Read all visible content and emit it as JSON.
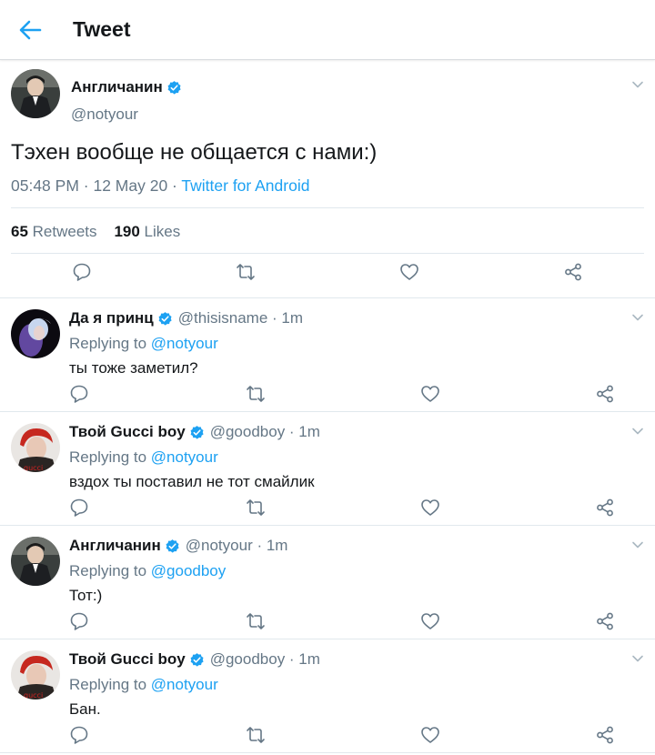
{
  "header": {
    "title": "Tweet"
  },
  "main_tweet": {
    "name": "Англичанин",
    "handle": "@notyour",
    "text": "Тэхен вообще не общается с нами:)",
    "time_date": "05:48 PM · 12 May 20 · ",
    "source": "Twitter for Android",
    "retweets_count": "65",
    "retweets_label": "Retweets",
    "likes_count": "190",
    "likes_label": "Likes"
  },
  "replies": [
    {
      "name": "Да я принц",
      "meta": "@thisisname · 1m",
      "replying_label": "Replying to ",
      "replying_to": "@notyour",
      "text": "ты тоже заметил?"
    },
    {
      "name": "Твой Gucci boy",
      "meta": "@goodboy · 1m",
      "replying_label": "Replying to ",
      "replying_to": "@notyour",
      "text": "вздох ты поставил не тот смайлик"
    },
    {
      "name": "Англичанин",
      "meta": "@notyour · 1m",
      "replying_label": "Replying to ",
      "replying_to": "@goodboy",
      "text": "Тот:)"
    },
    {
      "name": "Твой Gucci boy",
      "meta": "@goodboy · 1m",
      "replying_label": "Replying to ",
      "replying_to": "@notyour",
      "text": "Бан."
    }
  ],
  "colors": {
    "accent": "#1da1f2",
    "muted": "#657786",
    "text": "#14171a",
    "divider": "#e1e8ed"
  },
  "icons": [
    "back-arrow-icon",
    "verified-badge-icon",
    "chevron-down-icon",
    "reply-icon",
    "retweet-icon",
    "like-icon",
    "share-icon"
  ]
}
